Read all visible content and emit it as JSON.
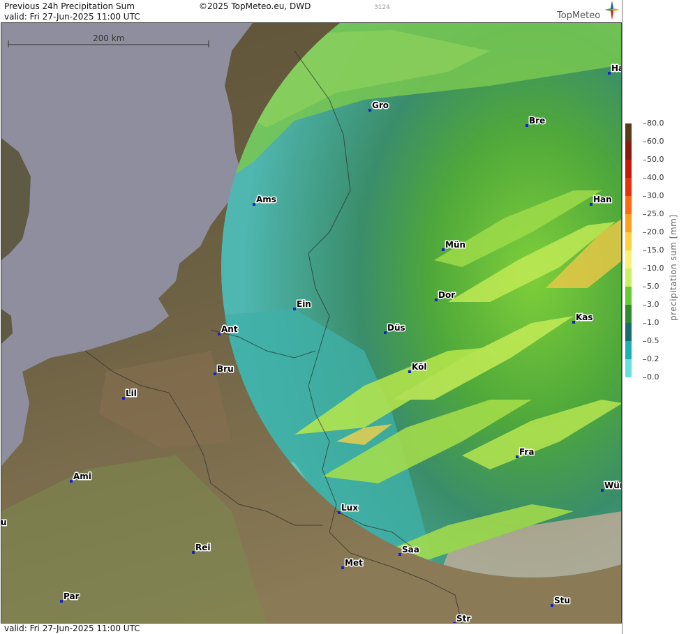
{
  "header": {
    "title": "Previous 24h Precipitation Sum",
    "valid": "valid:  Fri  27-Jun-2025 11:00 UTC",
    "copyright": "©2025 TopMeteo.eu, DWD",
    "code": "3124",
    "brand": "TopMeteo"
  },
  "footer": {
    "valid": "valid:  Fri  27-Jun-2025 11:00 UTC"
  },
  "scale": {
    "label": "200 km"
  },
  "legend": {
    "title": "precipitation sum [mm]",
    "levels": [
      "80.0",
      "60.0",
      "50.0",
      "40.0",
      "30.0",
      "25.0",
      "20.0",
      "15.0",
      "10.0",
      "5.0",
      "3.0",
      "1.0",
      "0.5",
      "0.2",
      "0.0"
    ],
    "colors": [
      "#5a3a18",
      "#8b1a0a",
      "#c41a0a",
      "#e8300a",
      "#ff6a10",
      "#ffa020",
      "#ffd040",
      "#f8f070",
      "#c8f060",
      "#66cc33",
      "#2e8b2e",
      "#166e6e",
      "#1ab0b8",
      "#66e0e0",
      "#ccf4f4"
    ]
  },
  "cities": [
    {
      "name": "Gro"
    },
    {
      "name": "Bre"
    },
    {
      "name": "Ha"
    },
    {
      "name": "Ams"
    },
    {
      "name": "Han"
    },
    {
      "name": "Mün"
    },
    {
      "name": "Ein"
    },
    {
      "name": "Dor"
    },
    {
      "name": "Kas"
    },
    {
      "name": "Ant"
    },
    {
      "name": "Düs"
    },
    {
      "name": "Bru"
    },
    {
      "name": "Köl"
    },
    {
      "name": "Lil"
    },
    {
      "name": "Fra"
    },
    {
      "name": "Ami"
    },
    {
      "name": "Wür"
    },
    {
      "name": "Lux"
    },
    {
      "name": "u"
    },
    {
      "name": "Rei"
    },
    {
      "name": "Saa"
    },
    {
      "name": "Met"
    },
    {
      "name": "Par"
    },
    {
      "name": "Stu"
    },
    {
      "name": "Str"
    }
  ],
  "colors": {
    "sea": "#8f8e9e",
    "land": "#6b5d42",
    "radar": "#3f8f3a",
    "dot": "#1a20c8"
  }
}
